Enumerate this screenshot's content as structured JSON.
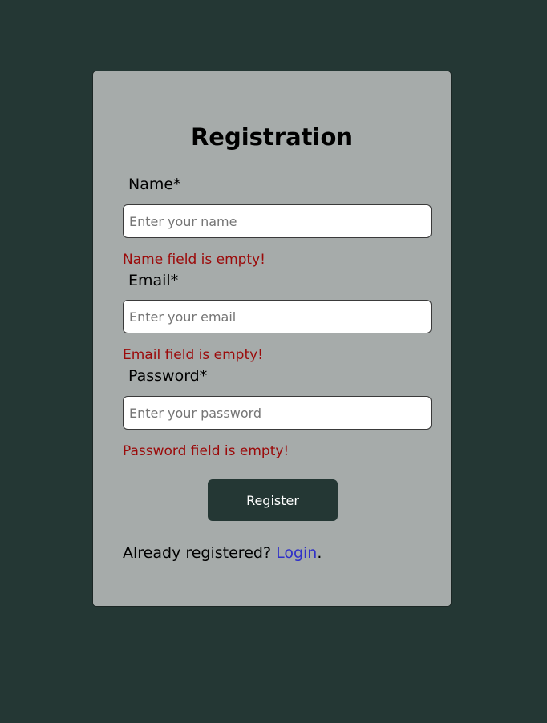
{
  "form": {
    "title": "Registration",
    "fields": [
      {
        "label": "Name*",
        "placeholder": "Enter your name",
        "value": "",
        "error": "Name field is empty!"
      },
      {
        "label": "Email*",
        "placeholder": "Enter your email",
        "value": "",
        "error": "Email field is empty!"
      },
      {
        "label": "Password*",
        "placeholder": "Enter your password",
        "value": "",
        "error": "Password field is empty!"
      }
    ],
    "submit_label": "Register",
    "footer": {
      "prefix": "Already registered? ",
      "link_label": "Login",
      "suffix": "."
    }
  },
  "colors": {
    "page_background": "#243734",
    "card_background": "#a6abaa",
    "error_text": "#9b0a0a",
    "button_background": "#243734",
    "link": "#2f2fc8"
  }
}
